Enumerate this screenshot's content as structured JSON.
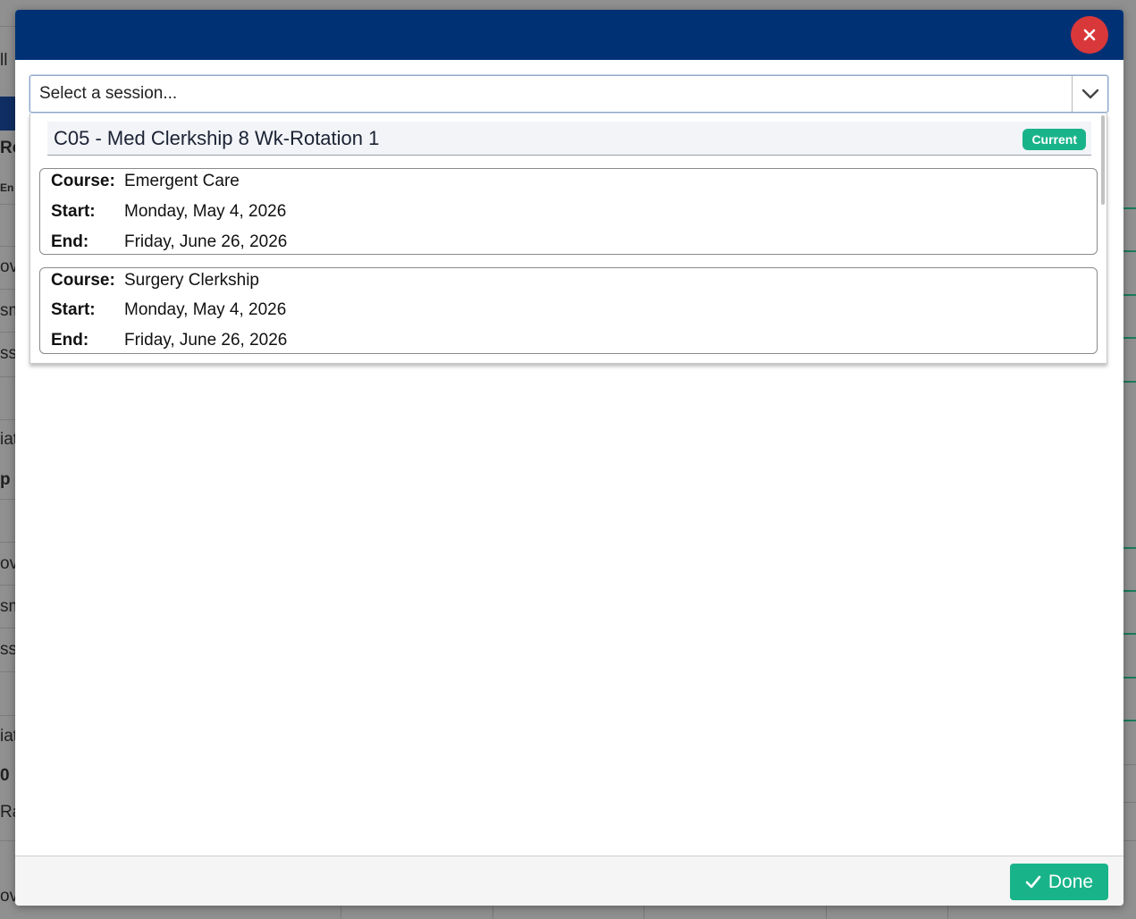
{
  "background": {
    "fragments": [
      {
        "text": "ll",
        "bold": false
      },
      {
        "text": "Ro",
        "bold": true
      },
      {
        "text": "En",
        "bold": true,
        "small": true
      },
      {
        "text": "ov",
        "bold": false
      },
      {
        "text": "sm",
        "bold": false
      },
      {
        "text": "ssi",
        "bold": false
      },
      {
        "text": "iat",
        "bold": false
      },
      {
        "text": "p",
        "bold": true
      },
      {
        "text": "ov",
        "bold": false
      },
      {
        "text": "sm",
        "bold": false
      },
      {
        "text": "ssi",
        "bold": false
      },
      {
        "text": "iat",
        "bold": false
      },
      {
        "text": "0",
        "bold": true
      },
      {
        "text": "Ra",
        "bold": false
      },
      {
        "text": "ov",
        "bold": false
      }
    ]
  },
  "modal": {
    "close_label": "×",
    "select": {
      "placeholder": "Select a session..."
    },
    "dropdown": {
      "group": {
        "title": "C05 - Med Clerkship 8 Wk-Rotation 1",
        "badge": "Current"
      },
      "options": [
        {
          "course_label": "Course:",
          "course": "Emergent Care",
          "start_label": "Start:",
          "start": "Monday, May 4, 2026",
          "end_label": "End:",
          "end": "Friday, June 26, 2026"
        },
        {
          "course_label": "Course:",
          "course": "Surgery Clerkship",
          "start_label": "Start:",
          "start": "Monday, May 4, 2026",
          "end_label": "End:",
          "end": "Friday, June 26, 2026"
        }
      ]
    },
    "footer": {
      "done_label": "Done"
    }
  },
  "colors": {
    "header": "#003175",
    "close": "#d9383a",
    "accent": "#19b38a"
  },
  "icons": {
    "close": "close-icon",
    "toggle": "chevron-down-icon",
    "done": "check-icon"
  }
}
